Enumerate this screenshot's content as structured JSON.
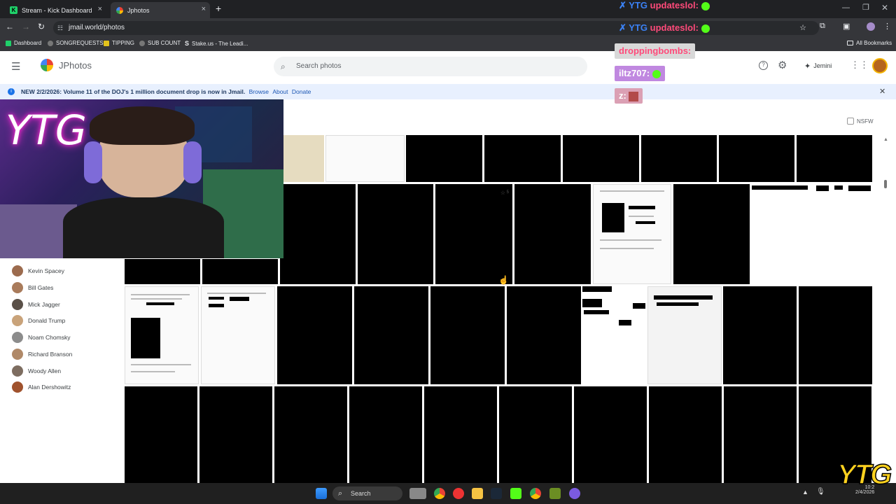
{
  "browser": {
    "tabs": [
      {
        "label": "Stream - Kick Dashboard",
        "close": "×"
      },
      {
        "label": "Jphotos",
        "close": "×"
      }
    ],
    "new_tab": "+",
    "url": "jmail.world/photos",
    "bookmarks": [
      "Dashboard",
      "SONGREQUESTS",
      "TIPPING",
      "SUB COUNT",
      "Stake.us - The Leadi..."
    ],
    "all_bookmarks": "All Bookmarks"
  },
  "app": {
    "title": "JPhotos",
    "search_placeholder": "Search photos",
    "assistant_label": "Jemini",
    "nsfw_label": "NSFW"
  },
  "banner": {
    "text": "NEW 2/2/2026: Volume 11 of the DOJ's 1 million document drop is now in Jmail.",
    "links": [
      "Browse",
      "About",
      "Donate"
    ]
  },
  "people": [
    "Kevin Spacey",
    "Bill Gates",
    "Mick Jagger",
    "Donald Trump",
    "Noam Chomsky",
    "Richard Branson",
    "Woody Allen",
    "Alan Dershowitz"
  ],
  "photo_overlay": {
    "star_count": "5"
  },
  "stream_overlay": {
    "webcam_tag": "YTG",
    "logo": "YTG",
    "chat_names": [
      "updateslol:",
      "updateslol:",
      "droppingbombs:",
      "iltz707:",
      "z:"
    ]
  },
  "taskbar": {
    "search_label": "Search",
    "clock_time": "10:2",
    "clock_date": "2/4/2026"
  },
  "colors": {
    "kick_green": "#53fc18",
    "accent_blue": "#1a73e8",
    "banner_bg": "#e8f0fe"
  }
}
